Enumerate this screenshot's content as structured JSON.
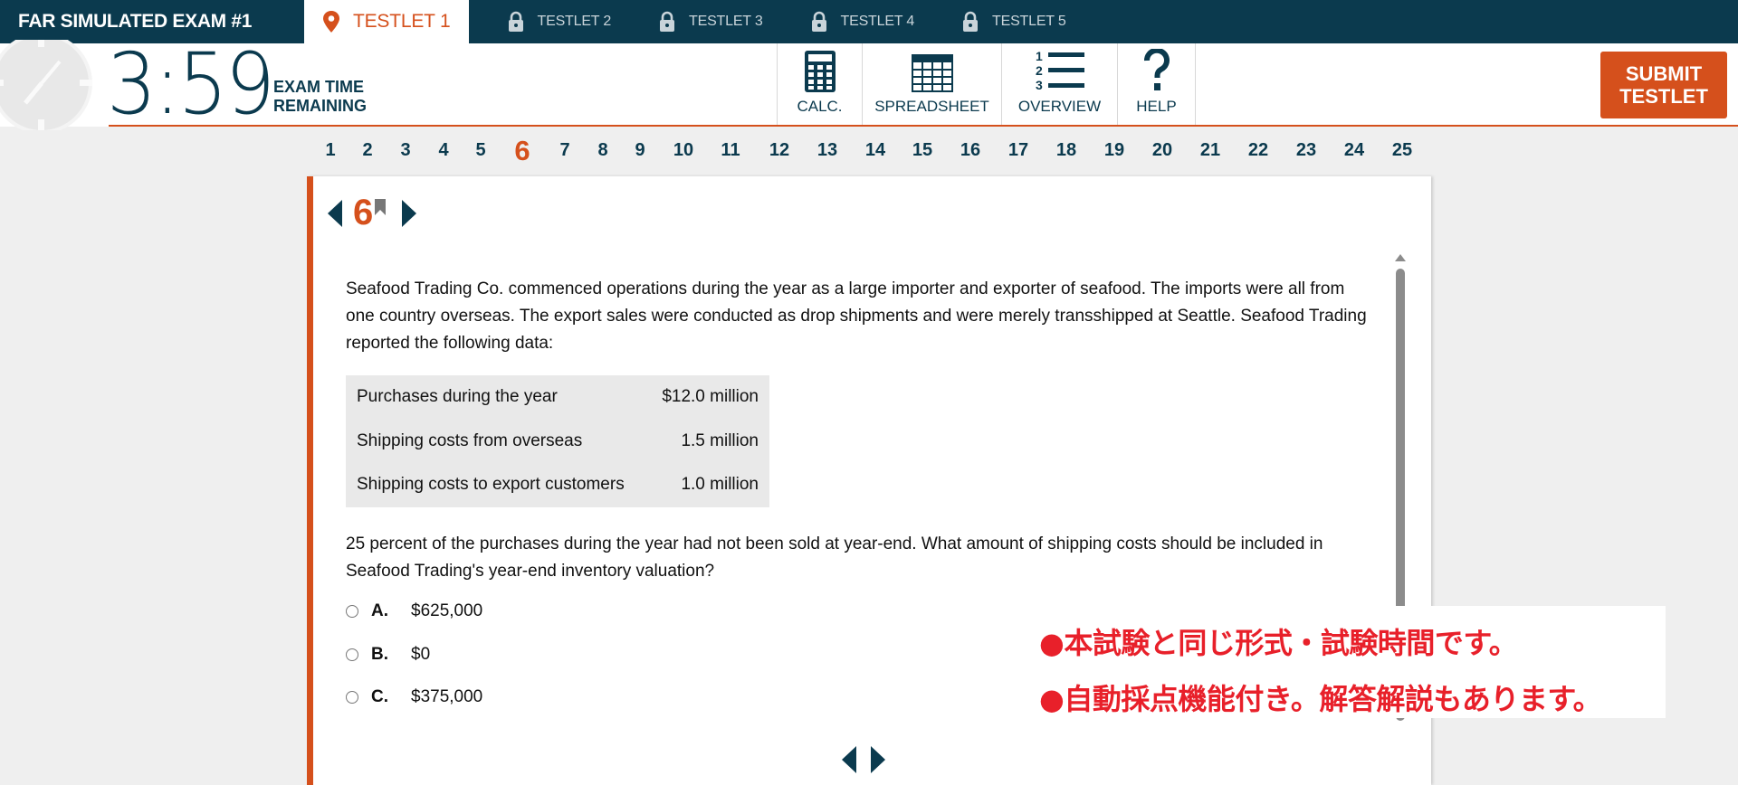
{
  "header": {
    "exam_title": "FAR SIMULATED EXAM #1",
    "tabs": [
      {
        "label": "TESTLET 1",
        "active": true,
        "icon": "location-pin-icon"
      },
      {
        "label": "TESTLET 2",
        "active": false,
        "icon": "lock-icon"
      },
      {
        "label": "TESTLET 3",
        "active": false,
        "icon": "lock-icon"
      },
      {
        "label": "TESTLET 4",
        "active": false,
        "icon": "lock-icon"
      },
      {
        "label": "TESTLET 5",
        "active": false,
        "icon": "lock-icon"
      }
    ]
  },
  "toolbar": {
    "timer": "3:59",
    "timer_label_line1": "EXAM TIME",
    "timer_label_line2": "REMAINING",
    "tools": [
      {
        "label": "CALC.",
        "icon": "calculator-icon"
      },
      {
        "label": "SPREADSHEET",
        "icon": "spreadsheet-icon"
      },
      {
        "label": "OVERVIEW",
        "icon": "numbered-list-icon"
      },
      {
        "label": "HELP",
        "icon": "question-mark-icon"
      }
    ],
    "submit_line1": "SUBMIT",
    "submit_line2": "TESTLET"
  },
  "question_numbers": [
    "1",
    "2",
    "3",
    "4",
    "5",
    "6",
    "7",
    "8",
    "9",
    "10",
    "11",
    "12",
    "13",
    "14",
    "15",
    "16",
    "17",
    "18",
    "19",
    "20",
    "21",
    "22",
    "23",
    "24",
    "25"
  ],
  "current_question": "6",
  "question": {
    "number": "6",
    "intro": "Seafood Trading Co. commenced operations during the year as a large importer and exporter of seafood. The imports were all from one country overseas. The export sales were conducted as drop shipments and were merely transshipped at Seattle. Seafood Trading reported the following data:",
    "table": [
      {
        "label": "Purchases during the year",
        "value": "$12.0 million"
      },
      {
        "label": "Shipping costs from overseas",
        "value": "1.5 million"
      },
      {
        "label": "Shipping costs to export customers",
        "value": "1.0 million"
      }
    ],
    "prompt": "25 percent of the purchases during the year had not been sold at year-end. What amount of shipping costs should be included in Seafood Trading's year-end inventory valuation?",
    "choices": [
      {
        "letter": "A.",
        "text": "$625,000"
      },
      {
        "letter": "B.",
        "text": "$0"
      },
      {
        "letter": "C.",
        "text": "$375,000"
      }
    ]
  },
  "promo": {
    "line1": "●本試験と同じ形式・試験時間です。",
    "line2": "●自動採点機能付き。解答解説もあります。"
  },
  "colors": {
    "navy": "#0b3a4e",
    "accent": "#d5501c",
    "promo_red": "#e8202a"
  }
}
